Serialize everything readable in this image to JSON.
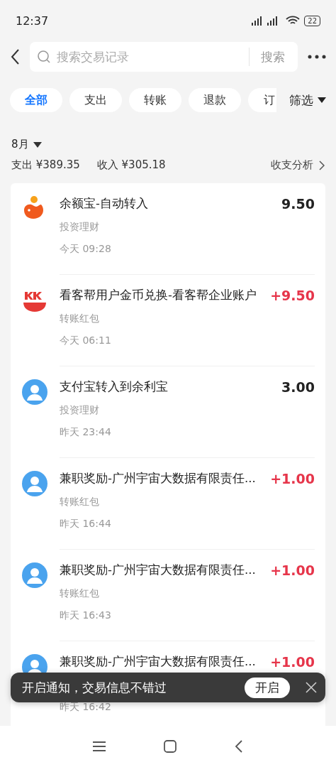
{
  "status_bar": {
    "time": "12:37",
    "battery": "22"
  },
  "search": {
    "placeholder": "搜索交易记录",
    "button": "搜索"
  },
  "tabs": [
    {
      "label": "全部",
      "selected": true
    },
    {
      "label": "支出",
      "selected": false
    },
    {
      "label": "转账",
      "selected": false
    },
    {
      "label": "退款",
      "selected": false
    },
    {
      "label": "订",
      "selected": false
    }
  ],
  "filter": "筛选",
  "month": "8月",
  "summary": {
    "expense": "支出 ¥389.35",
    "income": "收入 ¥305.18",
    "analysis": "收支分析"
  },
  "transactions": [
    {
      "kind": "yuebao",
      "title": "余额宝-自动转入",
      "category": "投资理财",
      "time": "今天 09:28",
      "amount": "9.50",
      "income": false
    },
    {
      "kind": "kkb",
      "title": "看客帮用户金币兑换-看客帮企业账户",
      "category": "转账红包",
      "time": "今天 06:11",
      "amount": "+9.50",
      "income": true
    },
    {
      "kind": "avatar",
      "title": "支付宝转入到余利宝",
      "category": "投资理财",
      "time": "昨天 23:44",
      "amount": "3.00",
      "income": false
    },
    {
      "kind": "avatar",
      "title": "兼职奖励-广州宇宙大数据有限责任...",
      "category": "转账红包",
      "time": "昨天 16:44",
      "amount": "+1.00",
      "income": true
    },
    {
      "kind": "avatar",
      "title": "兼职奖励-广州宇宙大数据有限责任...",
      "category": "转账红包",
      "time": "昨天 16:43",
      "amount": "+1.00",
      "income": true
    },
    {
      "kind": "avatar",
      "title": "兼职奖励-广州宇宙大数据有限责任...",
      "time": "昨天 16:42",
      "amount": "+1.00",
      "income": true
    }
  ],
  "toast": {
    "message": "开启通知，交易信息不错过",
    "button": "开启"
  }
}
